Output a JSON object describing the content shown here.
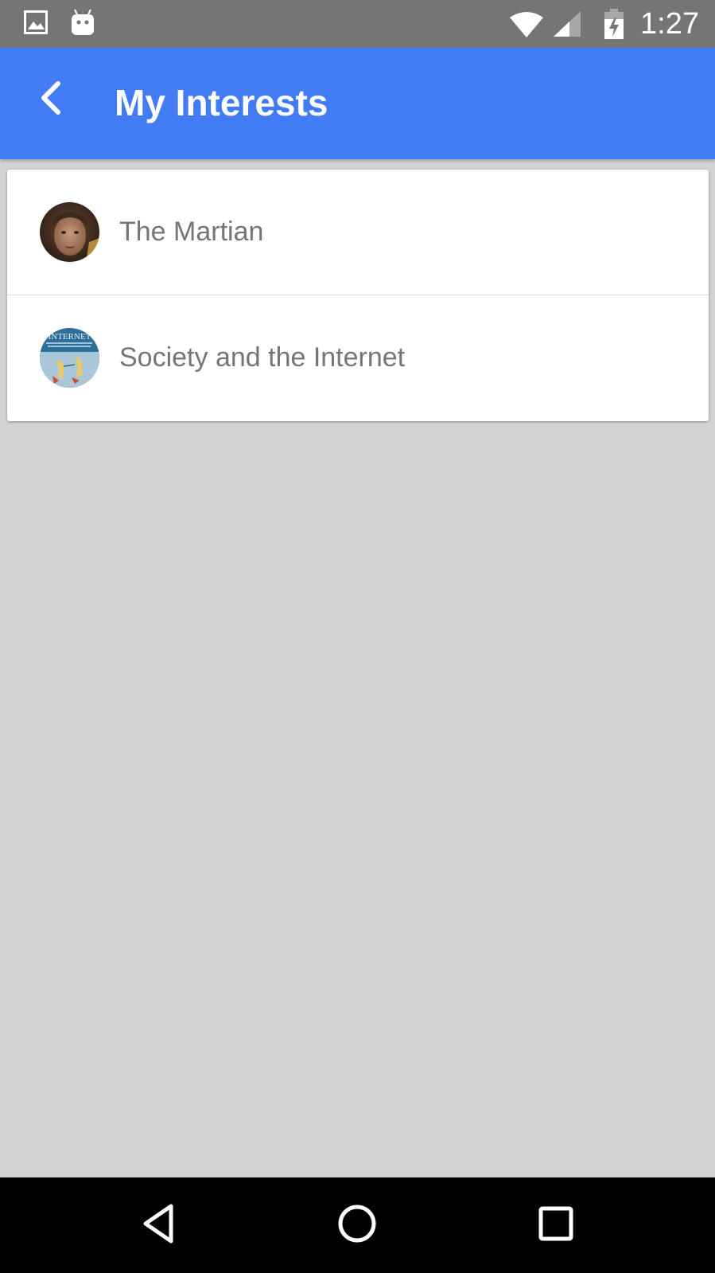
{
  "status_bar": {
    "time": "1:27",
    "icons": [
      "image-icon",
      "android-icon",
      "wifi-icon",
      "cell-signal-icon",
      "battery-charging-icon"
    ]
  },
  "app_bar": {
    "title": "My Interests",
    "back_icon": "chevron-left-icon",
    "color": "#427cf4"
  },
  "interests": [
    {
      "label": "The Martian",
      "avatar": "martian-avatar"
    },
    {
      "label": "Society and the Internet",
      "avatar": "society-internet-avatar",
      "avatar_text": "INTERNET"
    }
  ],
  "nav_bar": {
    "icons": [
      "back-triangle-icon",
      "home-circle-icon",
      "recents-square-icon"
    ]
  }
}
